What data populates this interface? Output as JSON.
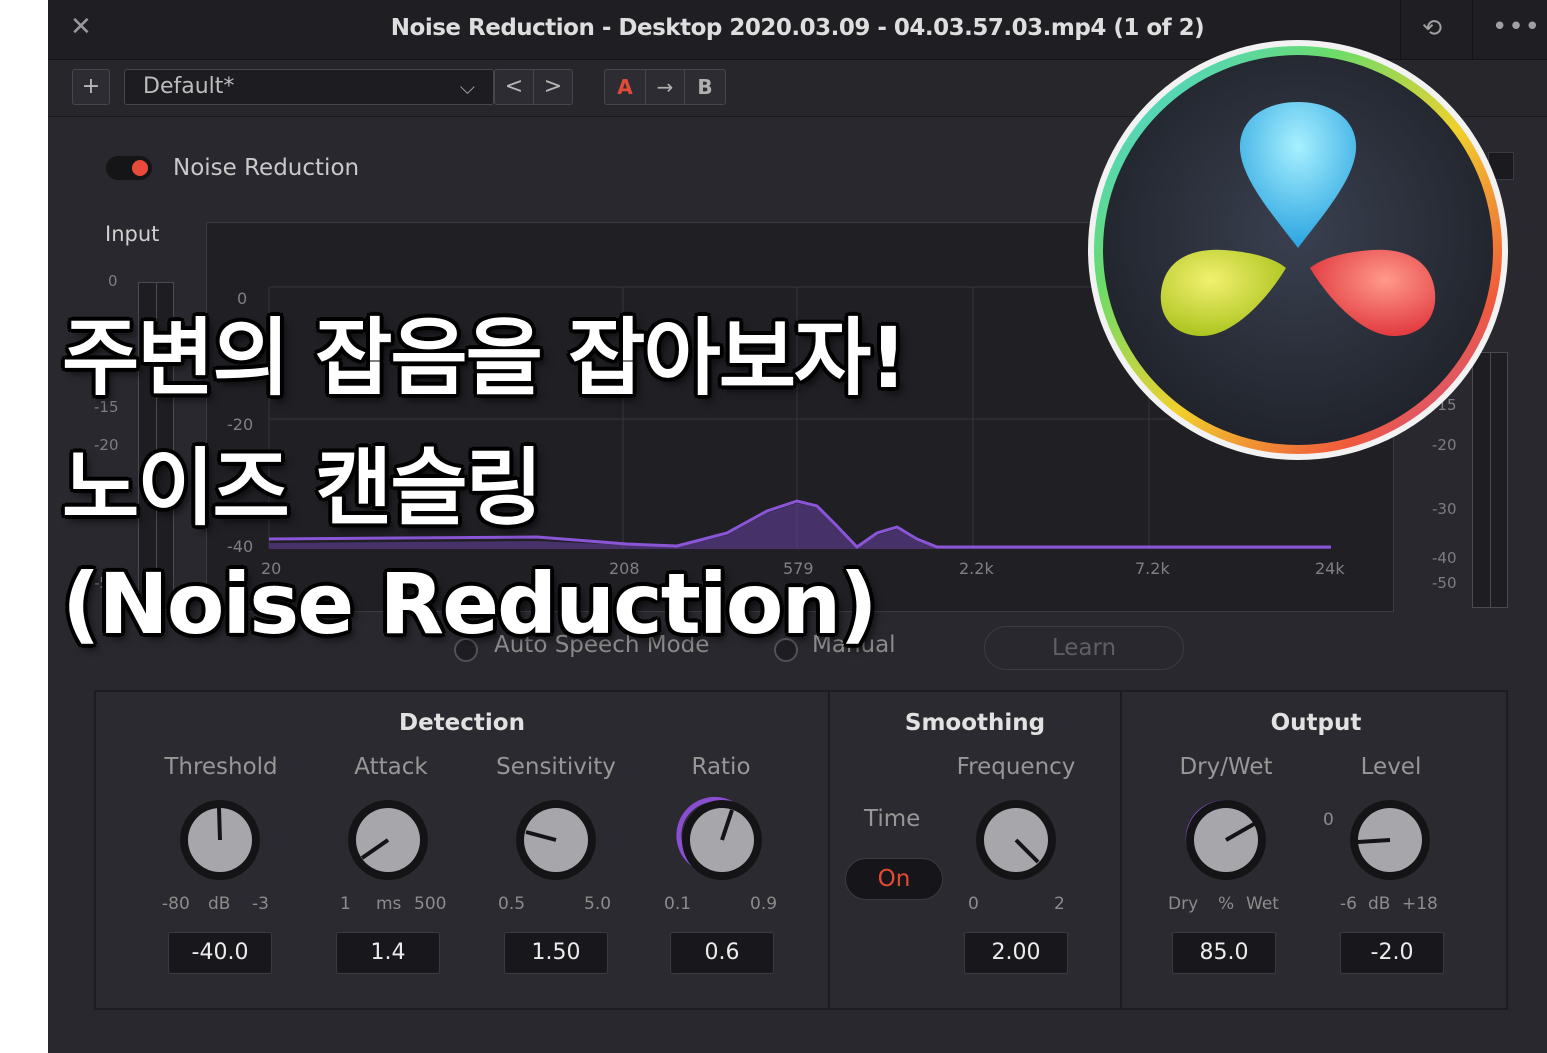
{
  "window": {
    "title": "Noise Reduction - Desktop 2020.03.09 - 04.03.57.03.mp4 (1 of 2)",
    "close_glyph": "✕",
    "history_glyph": "⟲",
    "more_glyph": "•••"
  },
  "toolbar": {
    "add_glyph": "+",
    "preset": "Default*",
    "dropdown_glyph": "⌵",
    "prev_glyph": "<",
    "next_glyph": ">",
    "a_label": "A",
    "arrow_glyph": "→",
    "b_label": "B"
  },
  "plugin": {
    "enable_label": "Noise Reduction",
    "input_label": "Input"
  },
  "input_meter": {
    "ticks": [
      "0",
      "-15",
      "-20",
      "-50"
    ]
  },
  "output_meter": {
    "ticks": [
      "-15",
      "-20",
      "-30",
      "-40",
      "-50"
    ]
  },
  "graph": {
    "y_labels": [
      "0",
      "-20",
      "-40"
    ],
    "x_labels": [
      "20",
      "208",
      "579",
      "2.2k",
      "7.2k",
      "24k"
    ]
  },
  "modes": {
    "auto": "Auto Speech Mode",
    "manual": "Manual",
    "learn_button": "Learn"
  },
  "detection": {
    "title": "Detection",
    "threshold": {
      "label": "Threshold",
      "min": "-80",
      "unit": "dB",
      "max": "-3",
      "value": "-40.0"
    },
    "attack": {
      "label": "Attack",
      "min": "1",
      "unit": "ms",
      "max": "500",
      "value": "1.4"
    },
    "sensitivity": {
      "label": "Sensitivity",
      "min": "0.5",
      "max": "5.0",
      "value": "1.50"
    },
    "ratio": {
      "label": "Ratio",
      "min": "0.1",
      "max": "0.9",
      "value": "0.6"
    }
  },
  "smoothing": {
    "title": "Smoothing",
    "time_label": "Time",
    "time_button": "On",
    "frequency": {
      "label": "Frequency",
      "min": "0",
      "max": "2",
      "value": "2.00"
    }
  },
  "output": {
    "title": "Output",
    "drywet": {
      "label": "Dry/Wet",
      "min": "Dry",
      "unit": "%",
      "max": "Wet",
      "value": "85.0"
    },
    "level": {
      "label": "Level",
      "zero": "0",
      "min": "-6",
      "unit": "dB",
      "max": "+18",
      "value": "-2.0"
    }
  },
  "overlay": {
    "line1": "주변의 잡음을 잡아보자!",
    "line2": "노이즈 캔슬링",
    "line3": "(Noise Reduction)"
  },
  "colors": {
    "accent_purple": "#8a4fd0",
    "record_red": "#e84a3c",
    "panel_bg": "#28282e"
  }
}
